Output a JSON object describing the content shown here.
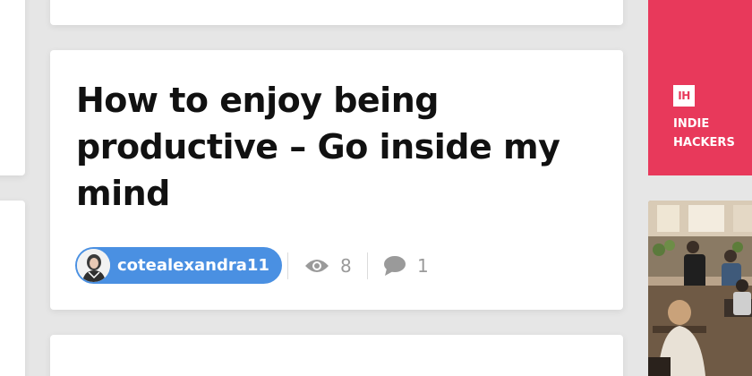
{
  "post": {
    "title": "How to enjoy being productive – Go inside my mind",
    "author": "cotealexandra11",
    "views": "8",
    "comments": "1"
  },
  "sidebar_ad": {
    "logo_text": "IH",
    "line1": "INDIE",
    "line2": "HACKERS"
  },
  "colors": {
    "accent_blue": "#4a90e2",
    "ih_red": "#e8395b",
    "icon_gray": "#9a9a9a"
  },
  "icons": [
    "eye-icon",
    "comment-icon"
  ]
}
